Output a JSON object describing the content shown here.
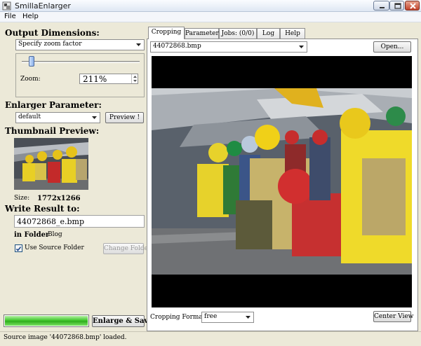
{
  "window": {
    "title": "SmillaEnlarger",
    "icon": "smilla-app-icon",
    "controls": [
      "minimize-icon",
      "maximize-icon",
      "close-icon"
    ]
  },
  "menu": [
    "File",
    "Help"
  ],
  "output": {
    "heading": "Output Dimensions:",
    "mode": "Specify zoom factor",
    "zoom_label": "Zoom:",
    "zoom_value": "211%",
    "slider_level_fraction": 0.1
  },
  "enlarger": {
    "heading": "Enlarger Parameter:",
    "preset": "default",
    "preview_button": "Preview !"
  },
  "thumbnail": {
    "heading": "Thumbnail Preview:",
    "size_label": "Size:",
    "size_value": "1772x1266"
  },
  "write_result": {
    "heading": "Write Result to:",
    "filename": "44072868_e.bmp",
    "folder_label": "in Folder",
    "folder_value": "Blog",
    "use_source_label": "Use Source Folder",
    "use_source_checked": true,
    "change_folder_button": "Change Folder"
  },
  "progress": {
    "fraction": 1.0,
    "color": "#43c82e"
  },
  "enlarge_button": "Enlarge & Save",
  "status": "Source image '44072868.bmp' loaded.",
  "tabs": [
    "Cropping",
    "Parameter",
    "Jobs: (0/0)",
    "Log",
    "Help"
  ],
  "active_tab": "Cropping",
  "cropping": {
    "source_file": "44072868.bmp",
    "open_button": "Open...",
    "format_label": "Cropping Format:",
    "format_value": "free",
    "center_view_button": "Center View"
  }
}
